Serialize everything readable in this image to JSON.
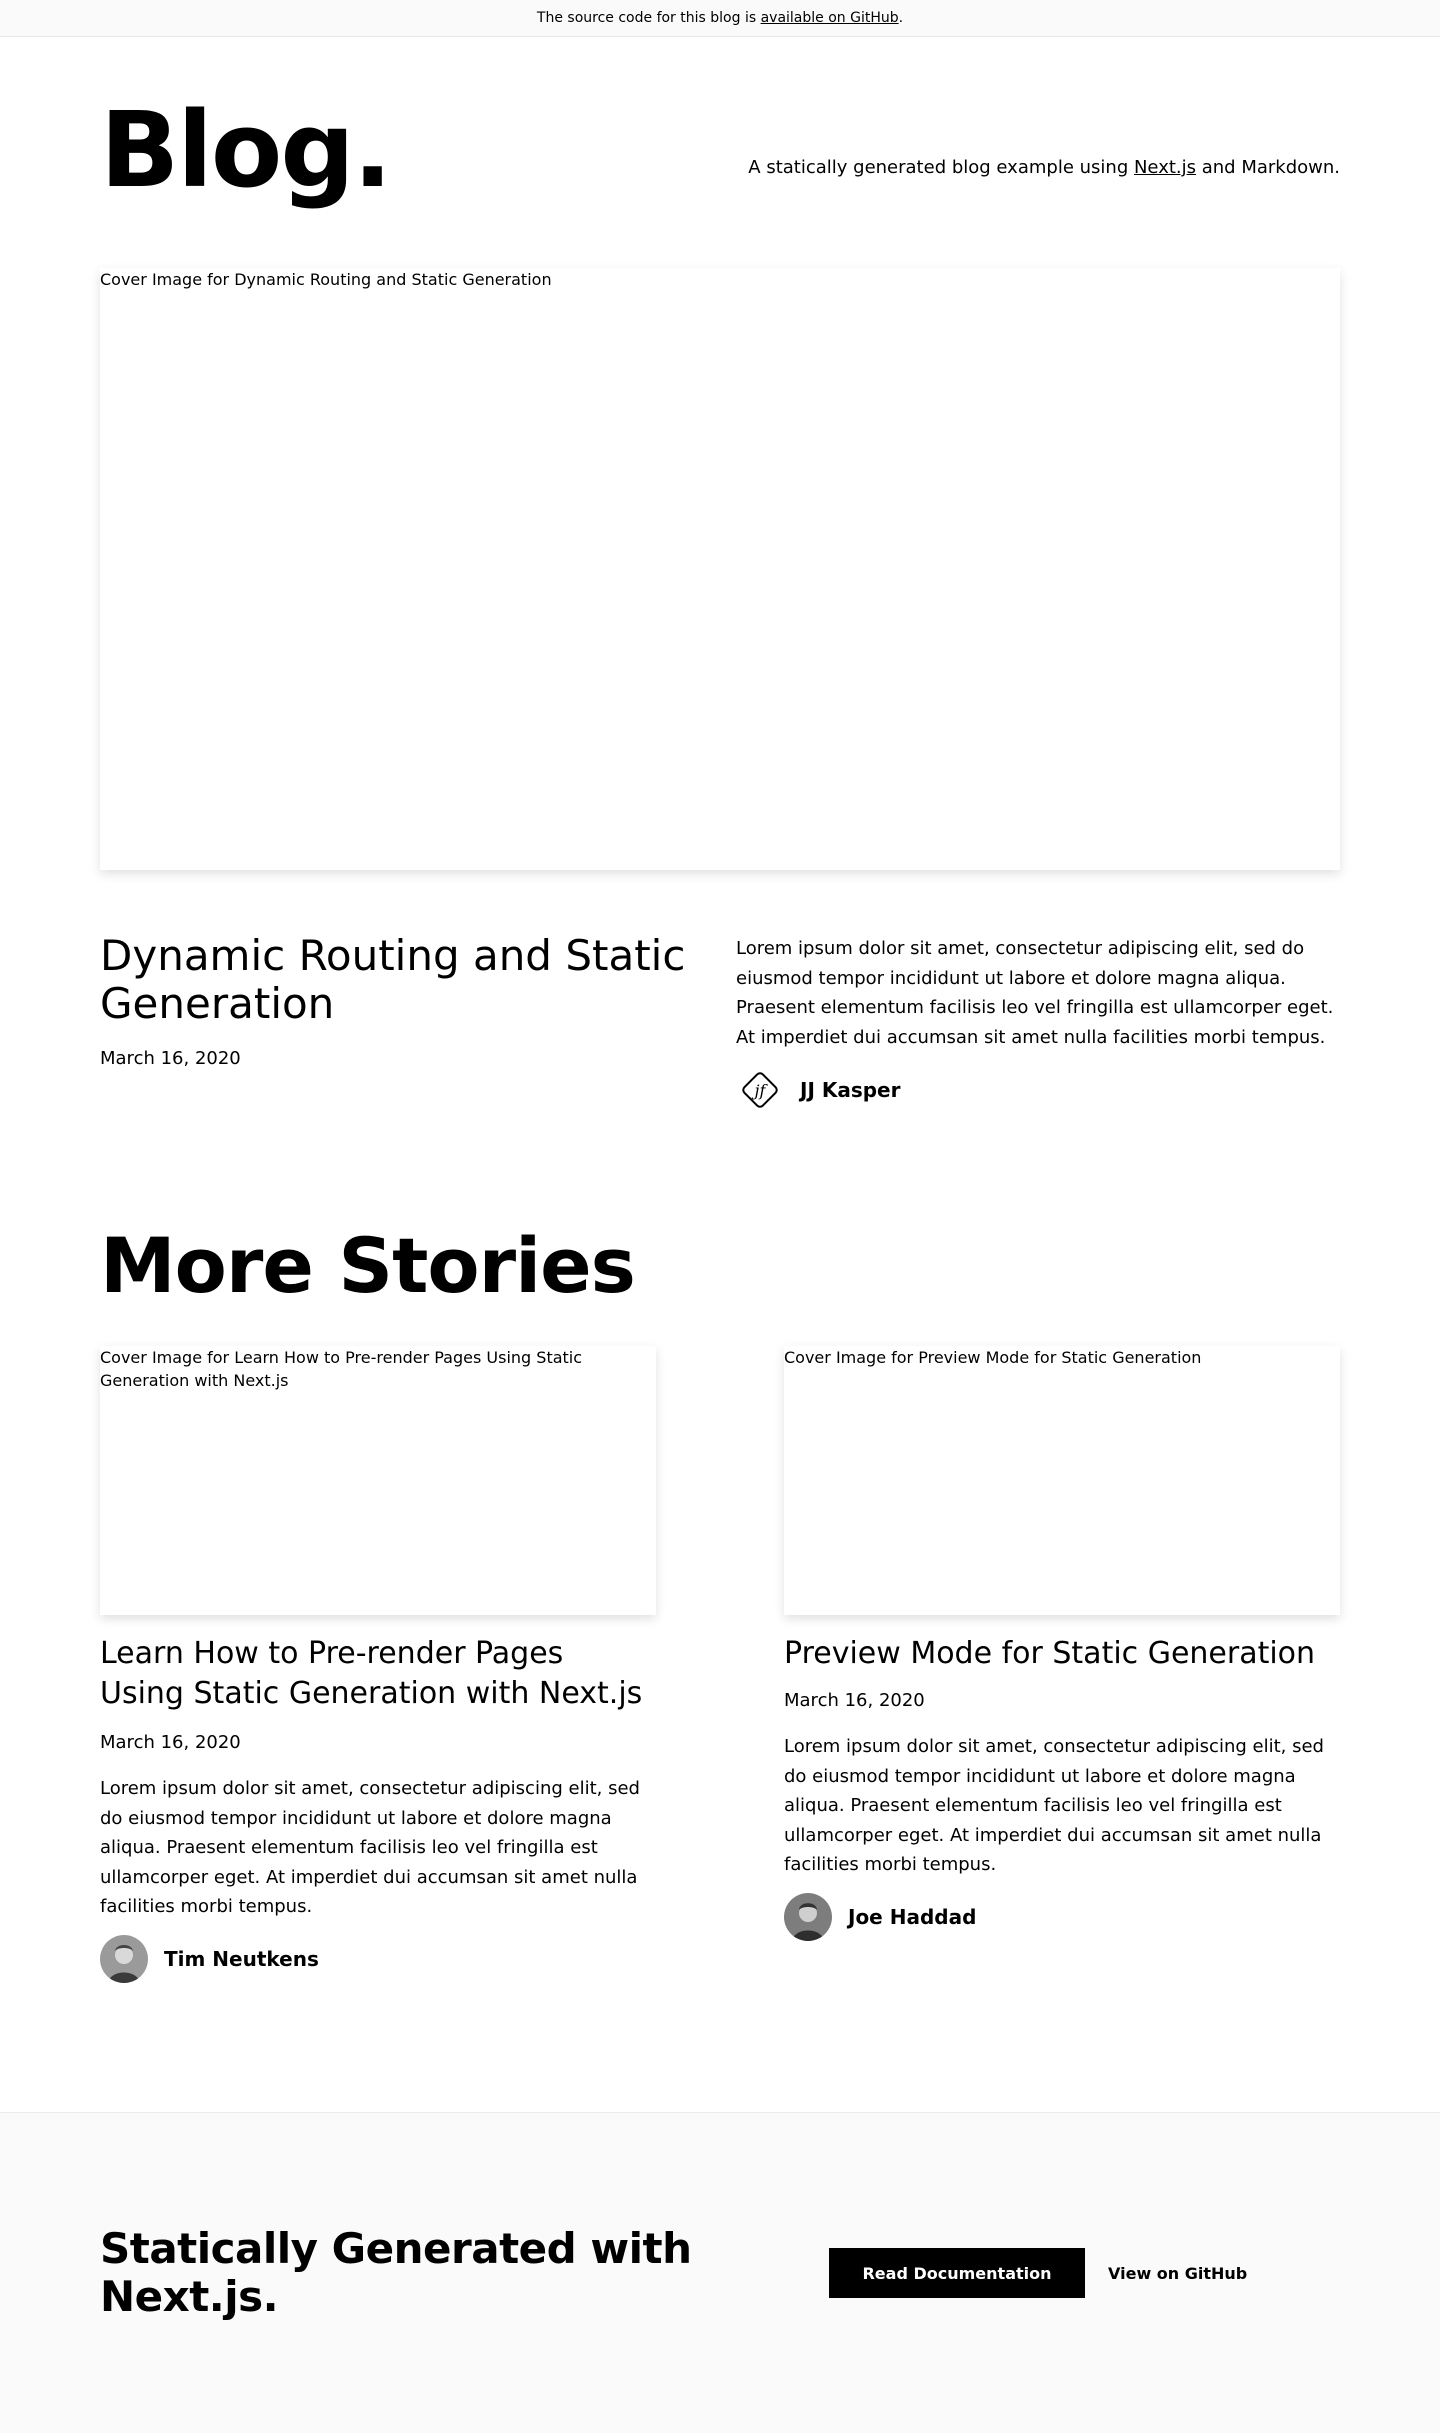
{
  "alert": {
    "prefix": "The source code for this blog is ",
    "link": "available on GitHub",
    "suffix": "."
  },
  "header": {
    "title": "Blog.",
    "intro_prefix": "A statically generated blog example using ",
    "intro_link": "Next.js",
    "intro_suffix": " and Markdown."
  },
  "hero": {
    "cover_alt": "Cover Image for Dynamic Routing and Static Generation",
    "title": "Dynamic Routing and Static Generation",
    "date": "March 16, 2020",
    "excerpt": "Lorem ipsum dolor sit amet, consectetur adipiscing elit, sed do eiusmod tempor incididunt ut labore et dolore magna aliqua. Praesent elementum facilisis leo vel fringilla est ullamcorper eget. At imperdiet dui accumsan sit amet nulla facilities morbi tempus.",
    "author": "JJ Kasper",
    "author_monogram": "jf"
  },
  "more_stories": {
    "heading": "More Stories",
    "posts": [
      {
        "cover_alt": "Cover Image for Learn How to Pre-render Pages Using Static Generation with Next.js",
        "title": "Learn How to Pre-render Pages Using Static Generation with Next.js",
        "date": "March 16, 2020",
        "excerpt": "Lorem ipsum dolor sit amet, consectetur adipiscing elit, sed do eiusmod tempor incididunt ut labore et dolore magna aliqua. Praesent elementum facilisis leo vel fringilla est ullamcorper eget. At imperdiet dui accumsan sit amet nulla facilities morbi tempus.",
        "author": "Tim Neutkens"
      },
      {
        "cover_alt": "Cover Image for Preview Mode for Static Generation",
        "title": "Preview Mode for Static Generation",
        "date": "March 16, 2020",
        "excerpt": "Lorem ipsum dolor sit amet, consectetur adipiscing elit, sed do eiusmod tempor incididunt ut labore et dolore magna aliqua. Praesent elementum facilisis leo vel fringilla est ullamcorper eget. At imperdiet dui accumsan sit amet nulla facilities morbi tempus.",
        "author": "Joe Haddad"
      }
    ]
  },
  "footer": {
    "title": "Statically Generated with Next.js.",
    "docs_button": "Read Documentation",
    "github_link": "View on GitHub"
  }
}
